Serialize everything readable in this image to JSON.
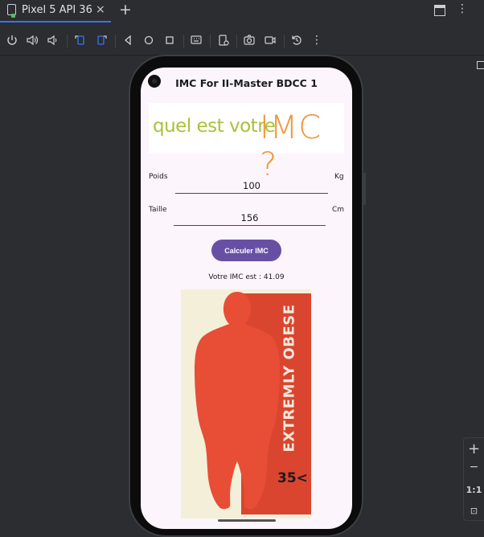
{
  "ide": {
    "tab": {
      "label": "Pixel 5 API 36",
      "close": "×"
    },
    "add_tab": "+",
    "toolbar": {
      "icons": [
        "power-icon",
        "volume-up-icon",
        "volume-down-icon",
        "rotate-left-icon",
        "rotate-right-icon",
        "back-icon",
        "home-icon",
        "overview-icon",
        "keyboard-icon",
        "fold-icon",
        "camera-icon",
        "record-icon",
        "restore-icon",
        "more-icon"
      ]
    },
    "zoom": {
      "plus": "+",
      "minus": "−",
      "ratio": "1:1"
    }
  },
  "app": {
    "title": "IMC For II-Master BDCC 1",
    "banner": {
      "part1": "quel est votre",
      "part2": "IMC ?"
    },
    "poids": {
      "label": "Poids",
      "value": "100",
      "unit": "Kg"
    },
    "taille": {
      "label": "Taille",
      "value": "156",
      "unit": "Cm"
    },
    "button_label": "Calculer IMC",
    "result": "Votre IMC est : 41.09",
    "image": {
      "category": "EXTREMLY OBESE",
      "range": "35<"
    }
  },
  "colors": {
    "accent": "#6750a4",
    "banner_green": "#a9c23a",
    "banner_orange": "#f0963a",
    "obese_red": "#e04832"
  }
}
